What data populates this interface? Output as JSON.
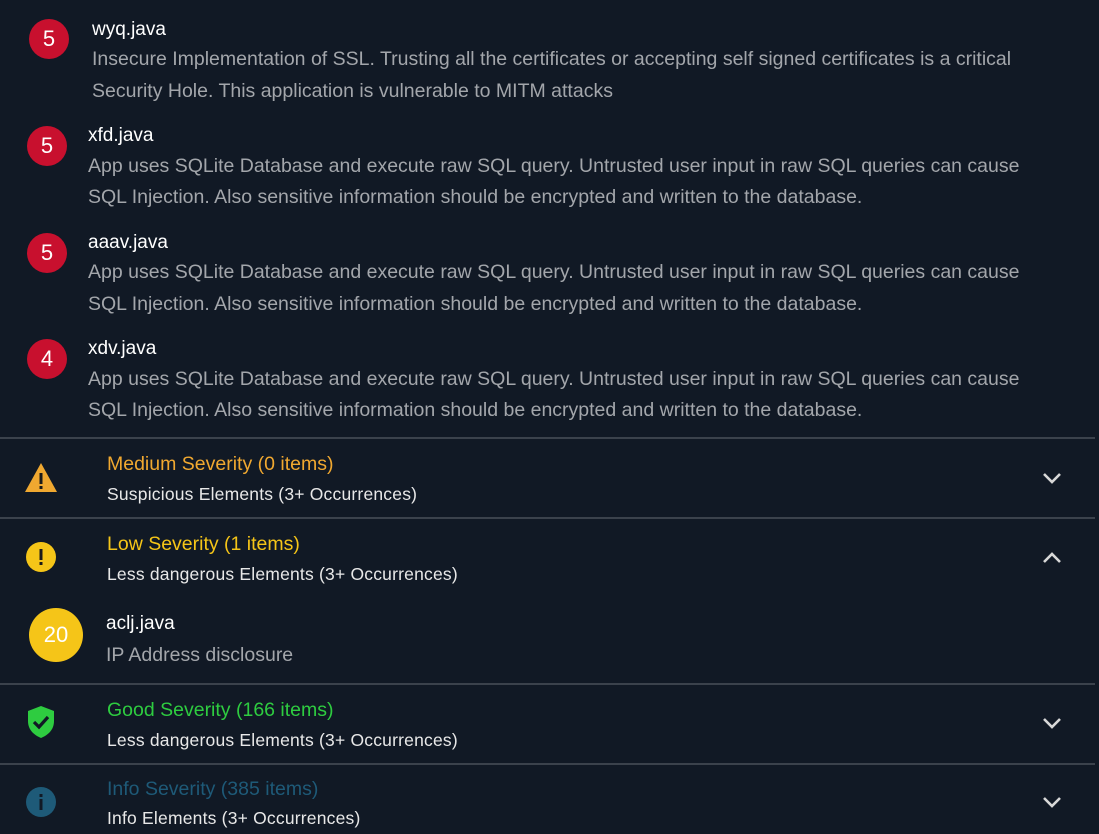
{
  "high_findings": [
    {
      "count": "5",
      "file": "wyq.java",
      "desc_line1": "Insecure Implementation of SSL. Trusting all the certificates or accepting self signed certificates is a critical",
      "desc_line2": "Security Hole. This application is vulnerable to MITM attacks"
    },
    {
      "count": "5",
      "file": "xfd.java",
      "desc_line1": "App uses SQLite Database and execute raw SQL query. Untrusted user input in raw SQL queries can cause",
      "desc_line2": "SQL Injection. Also sensitive information should be encrypted and written to the database."
    },
    {
      "count": "5",
      "file": "aaav.java",
      "desc_line1": "App uses SQLite Database and execute raw SQL query. Untrusted user input in raw SQL queries can cause",
      "desc_line2": "SQL Injection. Also sensitive information should be encrypted and written to the database."
    },
    {
      "count": "4",
      "file": "xdv.java",
      "desc_line1": "App uses SQLite Database and execute raw SQL query. Untrusted user input in raw SQL queries can cause",
      "desc_line2": "SQL Injection. Also sensitive information should be encrypted and written to the database."
    }
  ],
  "sections": {
    "medium": {
      "title": "Medium Severity (0 items)",
      "subtitle": "Suspicious Elements (3+ Occurrences)",
      "icon": "warning-triangle-icon",
      "color": "#f0a830",
      "expanded": false
    },
    "low": {
      "title": "Low Severity (1 items)",
      "subtitle": "Less dangerous Elements (3+ Occurrences)",
      "icon": "exclamation-circle-icon",
      "color": "#f5c518",
      "expanded": true
    },
    "good": {
      "title": "Good Severity (166 items)",
      "subtitle": "Less dangerous Elements (3+ Occurrences)",
      "icon": "shield-check-icon",
      "color": "#2ecc40",
      "expanded": false
    },
    "info": {
      "title": "Info Severity (385 items)",
      "subtitle": "Info Elements (3+ Occurrences)",
      "icon": "info-circle-icon",
      "color": "#1e5a78",
      "expanded": false
    }
  },
  "low_findings": [
    {
      "count": "20",
      "file": "aclj.java",
      "desc": "IP Address disclosure"
    }
  ]
}
